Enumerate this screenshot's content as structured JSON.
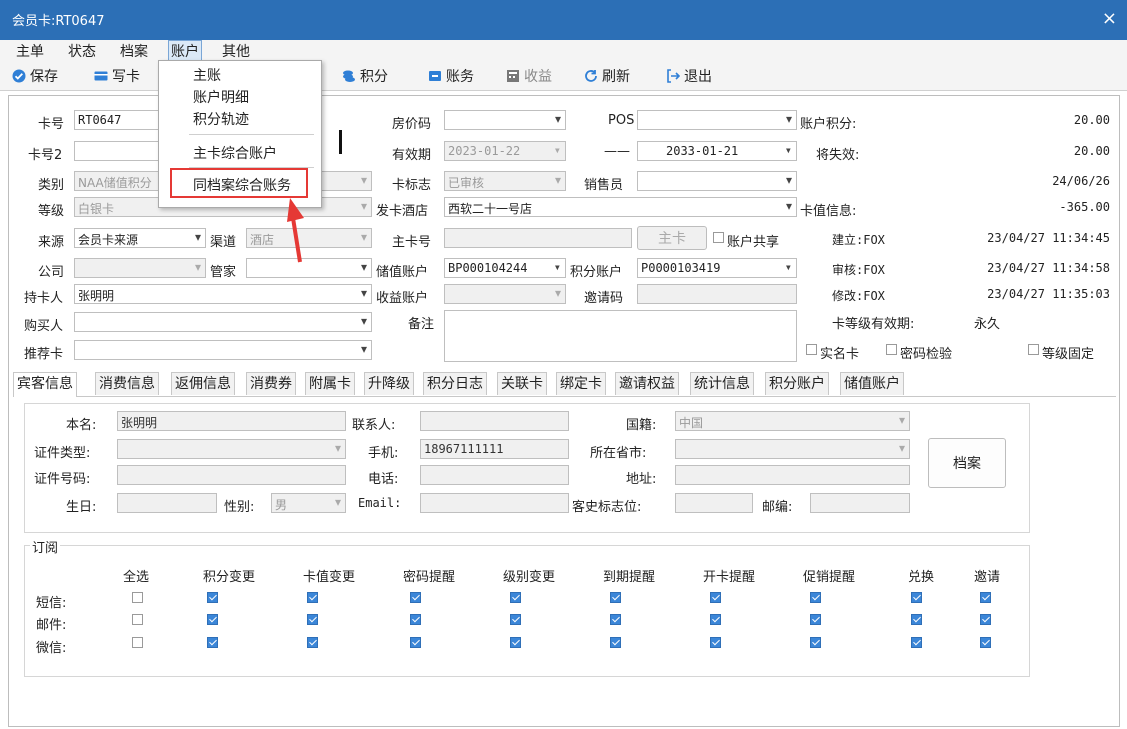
{
  "window": {
    "title": "会员卡:RT0647",
    "close": "×"
  },
  "menu": [
    "主单",
    "状态",
    "档案",
    "账户",
    "其他"
  ],
  "toolbar": {
    "save": "保存",
    "write": "写卡",
    "points": "积分",
    "account": "账务",
    "income": "收益",
    "refresh": "刷新",
    "exit": "退出"
  },
  "dropdown": [
    "主账",
    "账户明细",
    "积分轨迹",
    "主卡综合账户",
    "同档案综合账务"
  ],
  "form": {
    "card_no_label": "卡号",
    "card_no": "RT0647",
    "card_no2_label": "卡号2",
    "type_label": "类别",
    "type": "NAA储值积分",
    "level_label": "等级",
    "level": "白银卡",
    "source_label": "来源",
    "source": "会员卡来源",
    "channel_label": "渠道",
    "channel": "酒店",
    "company_label": "公司",
    "butler_label": "管家",
    "holder_label": "持卡人",
    "holder": "张明明",
    "buyer_label": "购买人",
    "referrer_label": "推荐卡",
    "room_code_label": "房价码",
    "pos_label": "POS",
    "valid_label": "有效期",
    "valid_from": "2023-01-22",
    "dash": "——",
    "valid_to": "2033-01-21",
    "card_flag_label": "卡标志",
    "card_flag": "已审核",
    "seller_label": "销售员",
    "hotel_label": "发卡酒店",
    "hotel": "西软二十一号店",
    "main_card_label": "主卡号",
    "main_card_btn": "主卡",
    "share_label": "账户共享",
    "stored_label": "储值账户",
    "stored": "BP000104244",
    "points_acc_label": "积分账户",
    "points_acc": "P0000103419",
    "income_label": "收益账户",
    "invite_label": "邀请码",
    "remark_label": "备注",
    "acc_points_label": "账户积分:",
    "acc_points": "20.00",
    "expire_label": "将失效:",
    "expire": "20.00",
    "date_val": "24/06/26",
    "card_value_label": "卡值信息:",
    "card_value": "-365.00",
    "created_label": "建立:FOX",
    "created": "23/04/27 11:34:45",
    "audited_label": "审核:FOX",
    "audited": "23/04/27 11:34:58",
    "modified_label": "修改:FOX",
    "modified": "23/04/27 11:35:03",
    "level_valid_label": "卡等级有效期:",
    "level_valid": "永久",
    "realname_label": "实名卡",
    "pwd_label": "密码检验",
    "level_fixed_label": "等级固定"
  },
  "tabs": [
    "宾客信息",
    "消费信息",
    "返佣信息",
    "消费券",
    "附属卡",
    "升降级",
    "积分日志",
    "关联卡",
    "绑定卡",
    "邀请权益",
    "统计信息",
    "积分账户",
    "储值账户"
  ],
  "guest": {
    "name_label": "本名:",
    "name": "张明明",
    "contact_label": "联系人:",
    "nation_label": "国籍:",
    "nation": "中国",
    "idtype_label": "证件类型:",
    "mobile_label": "手机:",
    "mobile": "18967111111",
    "province_label": "所在省市:",
    "idno_label": "证件号码:",
    "phone_label": "电话:",
    "address_label": "地址:",
    "birthday_label": "生日:",
    "gender_label": "性别:",
    "gender": "男",
    "email_label": "Email:",
    "history_label": "客史标志位:",
    "zip_label": "邮编:",
    "archive_btn": "档案"
  },
  "subscribe": {
    "title": "订阅",
    "columns": [
      "全选",
      "积分变更",
      "卡值变更",
      "密码提醒",
      "级别变更",
      "到期提醒",
      "开卡提醒",
      "促销提醒",
      "兑换",
      "邀请"
    ],
    "rows": [
      {
        "label": "短信:",
        "checks": [
          false,
          true,
          true,
          true,
          true,
          true,
          true,
          true,
          true,
          true
        ]
      },
      {
        "label": "邮件:",
        "checks": [
          false,
          true,
          true,
          true,
          true,
          true,
          true,
          true,
          true,
          true
        ]
      },
      {
        "label": "微信:",
        "checks": [
          false,
          true,
          true,
          true,
          true,
          true,
          true,
          true,
          true,
          true
        ]
      }
    ]
  }
}
